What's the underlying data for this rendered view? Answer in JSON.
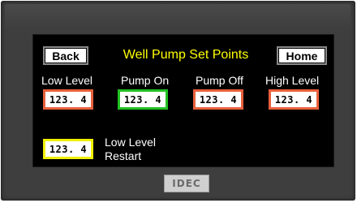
{
  "screen": {
    "title": "Well Pump Set Points",
    "back_label": "Back",
    "home_label": "Home"
  },
  "setpoints": [
    {
      "label": "Low Level",
      "value": "123. 4",
      "border_color": "#e8603c"
    },
    {
      "label": "Pump On",
      "value": "123. 4",
      "border_color": "#22c022"
    },
    {
      "label": "Pump Off",
      "value": "123. 4",
      "border_color": "#e8603c"
    },
    {
      "label": "High Level",
      "value": "123. 4",
      "border_color": "#e8603c"
    }
  ],
  "restart": {
    "label_line1": "Low Level",
    "label_line2": "Restart",
    "value": "123. 4",
    "border_color": "#f0f000"
  },
  "bezel": {
    "brand": "IDEC"
  },
  "colors": {
    "screen_bg": "#000000",
    "title": "#ffff00",
    "label": "#ffffff",
    "bezel": "#3e3e3e"
  }
}
